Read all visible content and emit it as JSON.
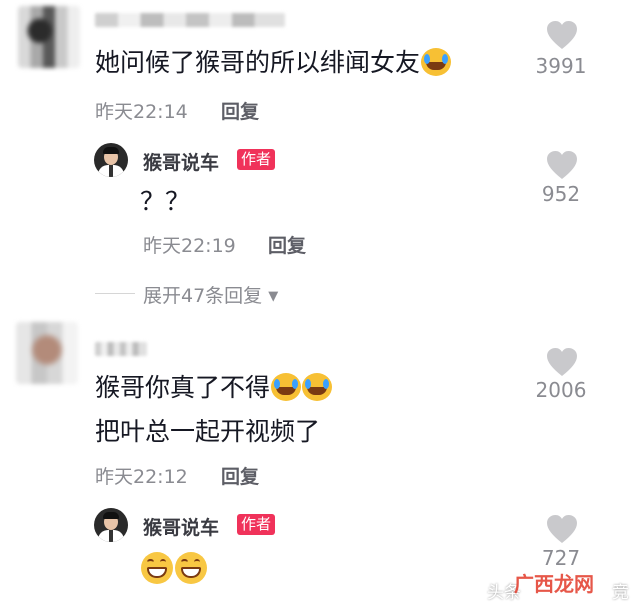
{
  "comments": [
    {
      "text": "她问候了猴哥的所以绯闻女友",
      "time": "昨天22:14",
      "reply_label": "回复",
      "likes": "3991",
      "author_reply": {
        "author": "猴哥说车",
        "badge": "作者",
        "text": "？？",
        "time": "昨天22:19",
        "reply_label": "回复",
        "likes": "952"
      },
      "expand_label": "展开47条回复"
    },
    {
      "text_line1": "猴哥你真了不得",
      "text_line2": "把叶总一起开视频了",
      "time": "昨天22:12",
      "reply_label": "回复",
      "likes": "2006",
      "author_reply": {
        "author": "猴哥说车",
        "badge": "作者",
        "likes": "727"
      }
    }
  ],
  "watermark": {
    "source": "头条",
    "overlay": "广西龙网",
    "suffix": "竞"
  },
  "icons": {
    "like": "heart-icon",
    "expand": "caret-down-icon",
    "emoji_cry_laugh": "tears-of-joy-emoji",
    "emoji_grin": "grinning-emoji"
  },
  "colors": {
    "badge": "#f0325a",
    "heart": "#c9c9cc",
    "text": "#161823",
    "muted": "#8a8b91"
  }
}
